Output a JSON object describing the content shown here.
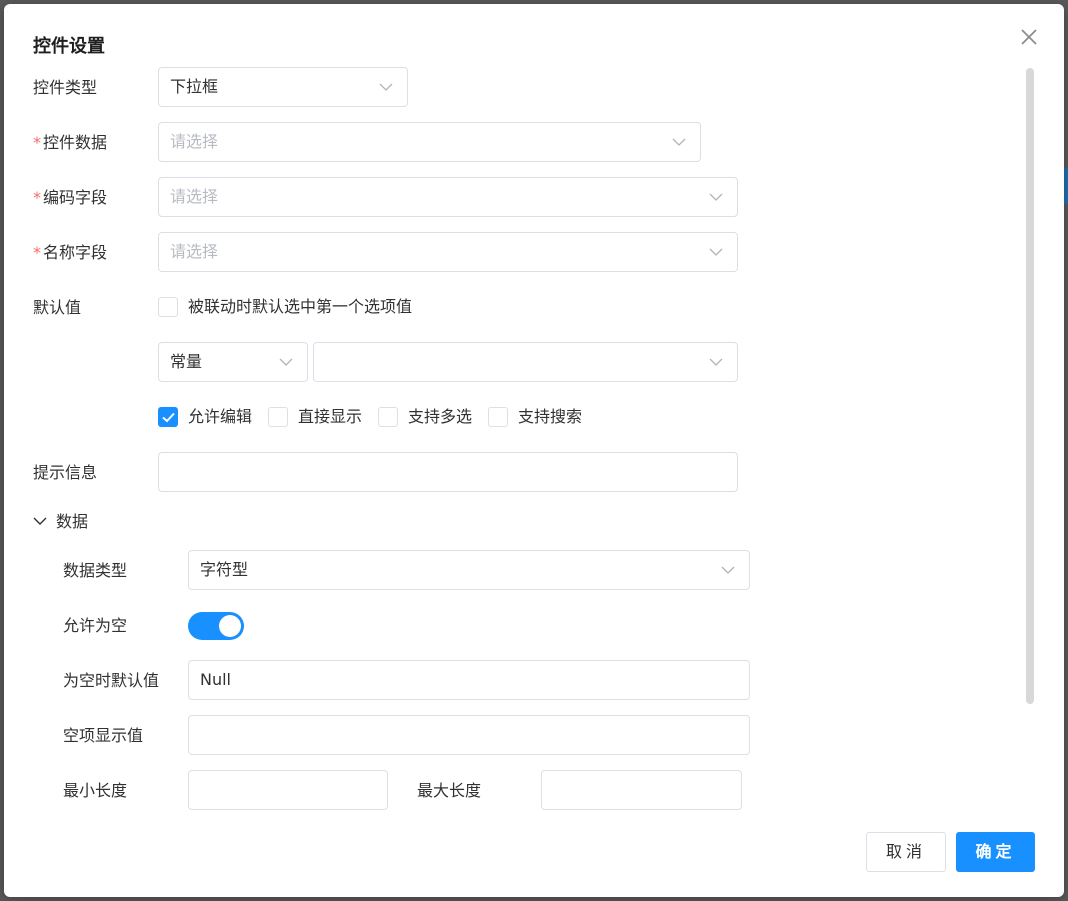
{
  "dialog": {
    "title": "控件设置"
  },
  "form": {
    "control_type": {
      "label": "控件类型",
      "value": "下拉框"
    },
    "control_data": {
      "required_mark": "*",
      "label": "控件数据",
      "placeholder": "请选择"
    },
    "code_field": {
      "required_mark": "*",
      "label": "编码字段",
      "placeholder": "请选择"
    },
    "name_field": {
      "required_mark": "*",
      "label": "名称字段",
      "placeholder": "请选择"
    },
    "default_value": {
      "label": "默认值",
      "linked_first_option": {
        "label": "被联动时默认选中第一个选项值",
        "checked": false
      },
      "source_type": "常量",
      "source_value": ""
    },
    "options": [
      {
        "label": "允许编辑",
        "checked": true
      },
      {
        "label": "直接显示",
        "checked": false
      },
      {
        "label": "支持多选",
        "checked": false
      },
      {
        "label": "支持搜索",
        "checked": false
      }
    ],
    "hint": {
      "label": "提示信息",
      "value": ""
    }
  },
  "data_section": {
    "title": "数据",
    "expanded": true,
    "data_type": {
      "label": "数据类型",
      "value": "字符型"
    },
    "allow_empty": {
      "label": "允许为空",
      "on": true
    },
    "empty_default": {
      "label": "为空时默认值",
      "value": "Null"
    },
    "empty_display": {
      "label": "空项显示值",
      "value": ""
    },
    "min_length": {
      "label": "最小长度",
      "value": ""
    },
    "max_length": {
      "label": "最大长度",
      "value": ""
    }
  },
  "footer": {
    "cancel": "取消",
    "ok": "确定"
  },
  "colors": {
    "primary": "#1890ff",
    "required": "#f56c6c",
    "border": "#dcdfe6",
    "placeholder": "#b8bbc2"
  }
}
